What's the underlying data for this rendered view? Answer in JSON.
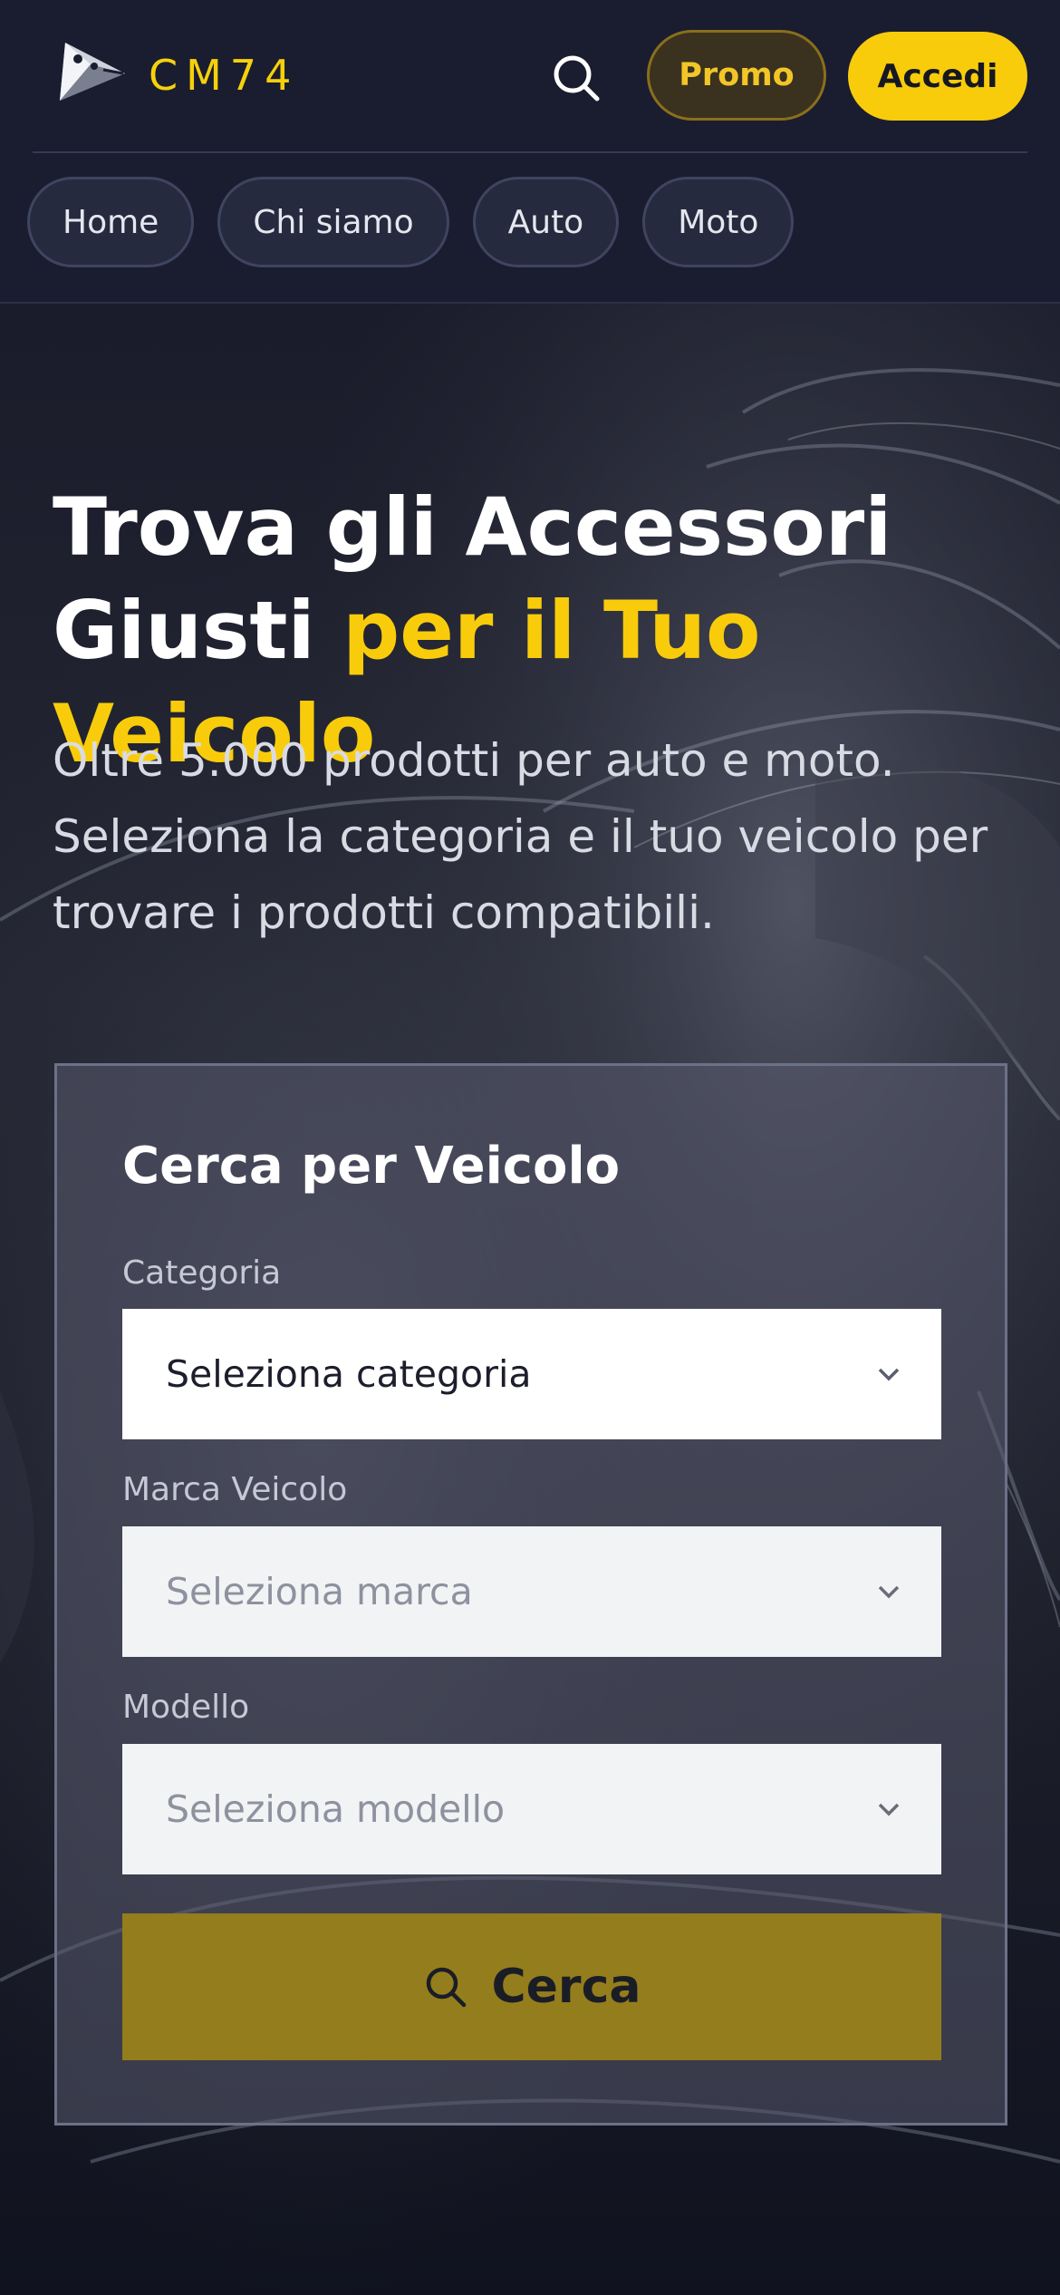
{
  "header": {
    "logo_text": "CM74",
    "promo_label": "Promo",
    "login_label": "Accedi",
    "nav": [
      "Home",
      "Chi siamo",
      "Auto",
      "Moto"
    ]
  },
  "hero": {
    "title_line1": "Trova gli Accessori",
    "title_line2_plain": "Giusti",
    "title_line2_accent": "per il Tuo Veicolo",
    "subtitle": "Oltre 5.000 prodotti per auto e moto. Seleziona la categoria e il tuo veicolo per trovare i prodotti compatibili."
  },
  "search_card": {
    "title": "Cerca per Veicolo",
    "fields": [
      {
        "label": "Categoria",
        "placeholder": "Seleziona categoria"
      },
      {
        "label": "Marca Veicolo",
        "placeholder": "Seleziona marca"
      },
      {
        "label": "Modello",
        "placeholder": "Seleziona modello"
      }
    ],
    "button_label": "Cerca"
  },
  "colors": {
    "accent": "#f9cc0b",
    "header_bg": "#1a1d30",
    "page_bg": "#0f1423"
  },
  "icons": {
    "search": "search-icon",
    "chevron": "chevron-down-icon",
    "logo": "logo-mark-icon"
  }
}
